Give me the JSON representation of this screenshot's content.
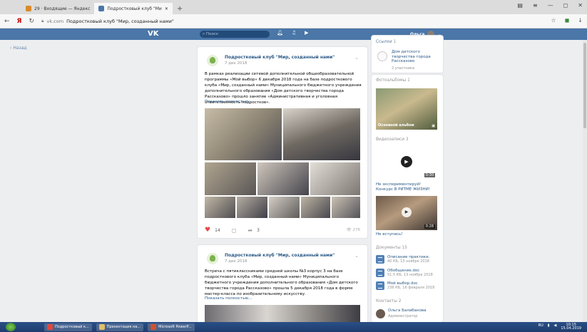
{
  "browser": {
    "tabs": [
      {
        "label": "29 · Входящие — Яндекс",
        "color": "#d88b2a"
      },
      {
        "label": "Подростковый клуб \"Ми",
        "color": "#4a76a8"
      }
    ],
    "url_domain": "vk.com",
    "url_title": "Подростковый клуб \"Мир, созданный нами\""
  },
  "vk": {
    "search_placeholder": "Поиск",
    "user_name": "Ольга",
    "back": "Назад"
  },
  "post1": {
    "author": "Подростковый клуб \"Мир, созданный нами\"",
    "date": "7 дек 2018",
    "text": "В рамках реализации сетевой дополнительной общеобразовательной программы «Мой выбор» 6 декабря 2018 года на базе подросткового клуба «Мир, созданный нами» Муниципального бюджетного учреждения дополнительного образования «Дом детского творчества города Рассказово» прошло занятие «Административная и уголовная ответственность подростков».",
    "more": "Показать полностью...",
    "likes": "14",
    "shares": "3",
    "views": "276"
  },
  "post2": {
    "author": "Подростковый клуб \"Мир, созданный нами\"",
    "date": "7 дек 2018",
    "text": "Встреча с пятиклассниками средней школы №3 корпус 3 на базе подросткового клуба «Мир, созданный нами» Муниципального бюджетного учреждения дополнительного образования «Дом детского творчества города Рассказово» прошла 5 декабря 2018 года в форме мастер-класса по изобразительному искусству.",
    "more": "Показать полностью..."
  },
  "sidebar": {
    "links_title": "Ссылки",
    "links_count": "1",
    "link_name": "Дом детского творчества города Рассказово",
    "link_sub": "2 участника",
    "albums_title": "Фотоальбомы",
    "albums_count": "1",
    "album_name": "Основной альбом",
    "videos_title": "Видеозаписи",
    "videos_count": "3",
    "video1_duration": "0:30",
    "video1_title": "Не экспериментируй! Конкурс В РИТМЕ ЖИЗНИ!",
    "video2_duration": "0:28",
    "video2_title": "Не вступись!",
    "docs_title": "Документы",
    "docs_count": "15",
    "docs": [
      {
        "name": "Описание практики.",
        "meta": "40 КБ, 13 ноября 2018"
      },
      {
        "name": "Обобщение.doc",
        "meta": "51.5 КБ, 13 ноября 2018"
      },
      {
        "name": "Мой выбор.doc",
        "meta": "236 КБ, 16 февраля 2018"
      }
    ],
    "contacts_title": "Контакты",
    "contacts_count": "2",
    "contact_name": "Ольга Балабанова",
    "contact_role": "Администратор"
  },
  "taskbar": {
    "items": [
      "Подростковый к...",
      "Презентация на...",
      "Microsoft PowerP..."
    ],
    "lang": "RU",
    "time": "10:15",
    "date": "15.04.2019"
  },
  "colors": {
    "vk_blue": "#4a76a8",
    "link": "#2a5885"
  }
}
